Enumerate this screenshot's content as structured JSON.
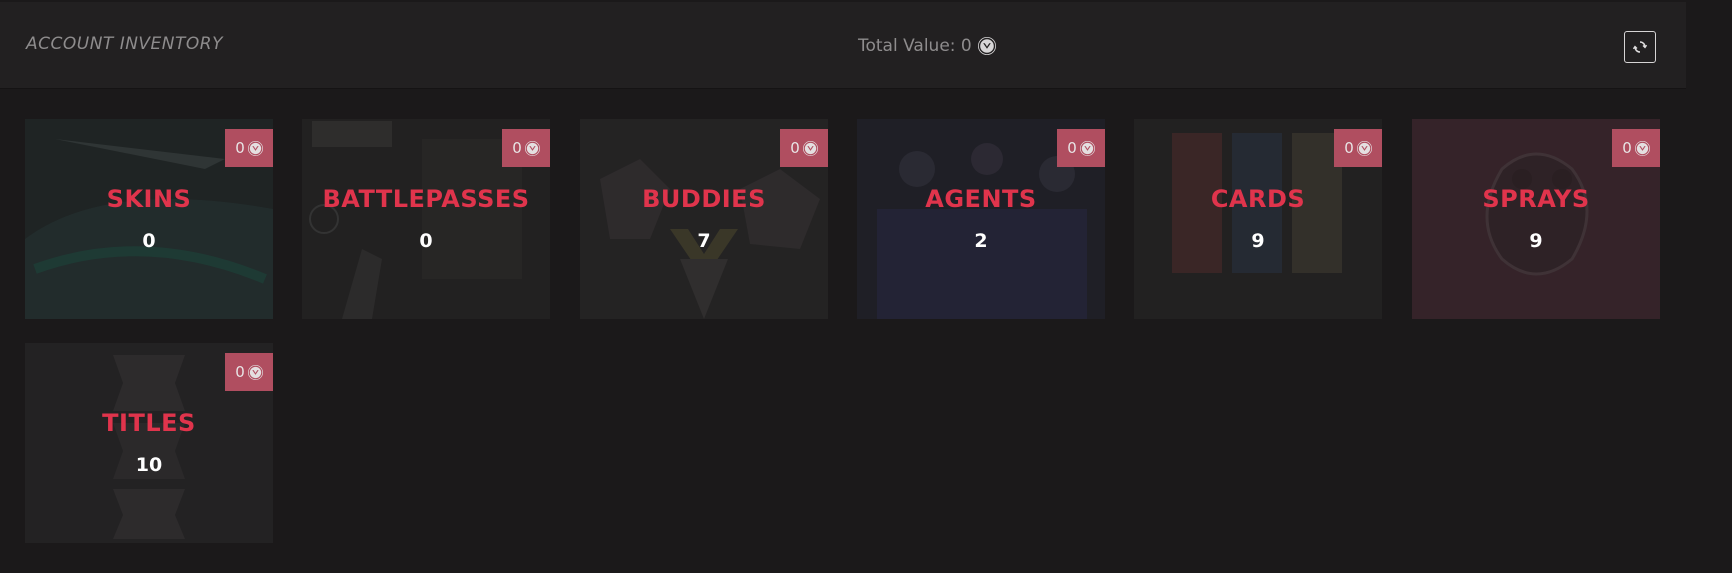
{
  "header": {
    "title": "ACCOUNT INVENTORY",
    "total_value_label": "Total Value: 0",
    "refresh_icon": "refresh-icon",
    "currency_icon": "valorant-points-icon"
  },
  "colors": {
    "accent": "#e0344c",
    "badge": "#b04e60",
    "background": "#1b191a",
    "header_bg": "#222021"
  },
  "cards": [
    {
      "title": "SKINS",
      "count": "0",
      "value": "0"
    },
    {
      "title": "BATTLEPASSES",
      "count": "0",
      "value": "0"
    },
    {
      "title": "BUDDIES",
      "count": "7",
      "value": "0"
    },
    {
      "title": "AGENTS",
      "count": "2",
      "value": "0"
    },
    {
      "title": "CARDS",
      "count": "9",
      "value": "0"
    },
    {
      "title": "SPRAYS",
      "count": "9",
      "value": "0"
    },
    {
      "title": "TITLES",
      "count": "10",
      "value": "0"
    }
  ]
}
